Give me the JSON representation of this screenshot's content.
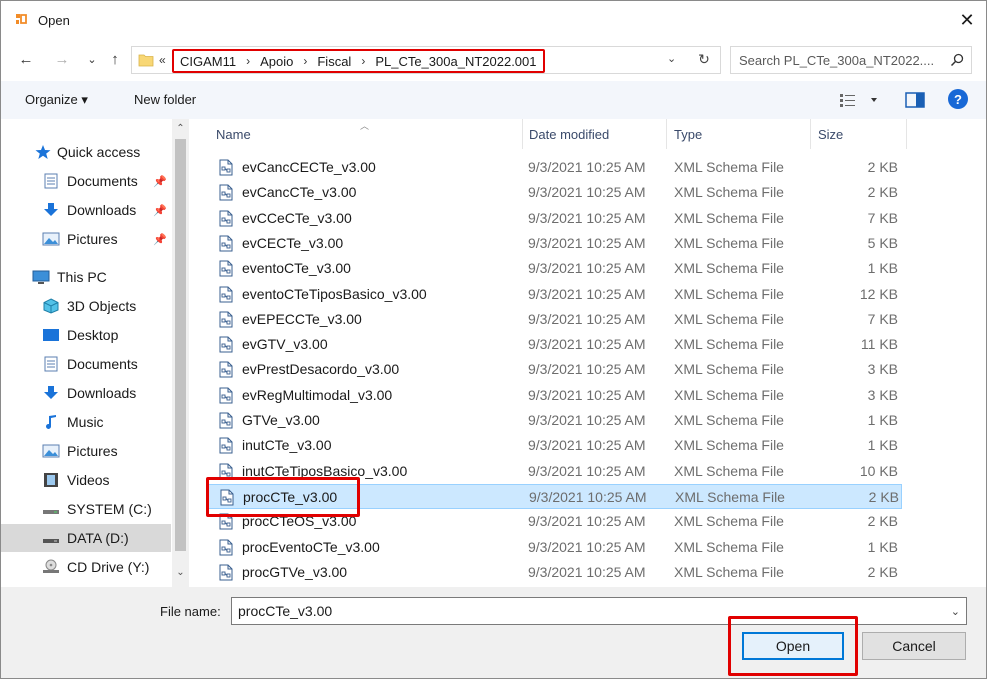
{
  "window": {
    "title": "Open",
    "close_glyph": "✕"
  },
  "address": {
    "overflow": "«",
    "crumbs": [
      "CIGAM11",
      "Apoio",
      "Fiscal",
      "PL_CTe_300a_NT2022.001"
    ],
    "separator": "›",
    "dropdown_glyph": "⌄",
    "refresh_glyph": "↻"
  },
  "nav_buttons": {
    "back": "←",
    "forward": "→",
    "recent": "⌄",
    "up": "↑"
  },
  "search": {
    "placeholder": "Search PL_CTe_300a_NT2022...."
  },
  "toolbar": {
    "organize": "Organize ▾",
    "new_folder": "New folder",
    "help": "?"
  },
  "nav_pane": {
    "items": [
      {
        "label": "Quick access",
        "icon": "star-icon",
        "pinned": false,
        "selected": false
      },
      {
        "label": "Documents",
        "icon": "documents-icon",
        "pinned": true,
        "selected": false
      },
      {
        "label": "Downloads",
        "icon": "downloads-icon",
        "pinned": true,
        "selected": false
      },
      {
        "label": "Pictures",
        "icon": "pictures-icon",
        "pinned": true,
        "selected": false
      },
      {
        "label": "This PC",
        "icon": "pc-icon",
        "pinned": false,
        "selected": false
      },
      {
        "label": "3D Objects",
        "icon": "cube-icon",
        "pinned": false,
        "selected": false
      },
      {
        "label": "Desktop",
        "icon": "desktop-icon",
        "pinned": false,
        "selected": false
      },
      {
        "label": "Documents",
        "icon": "documents-icon",
        "pinned": false,
        "selected": false
      },
      {
        "label": "Downloads",
        "icon": "downloads-icon",
        "pinned": false,
        "selected": false
      },
      {
        "label": "Music",
        "icon": "music-icon",
        "pinned": false,
        "selected": false
      },
      {
        "label": "Pictures",
        "icon": "pictures-icon",
        "pinned": false,
        "selected": false
      },
      {
        "label": "Videos",
        "icon": "videos-icon",
        "pinned": false,
        "selected": false
      },
      {
        "label": "SYSTEM (C:)",
        "icon": "drive-icon",
        "pinned": false,
        "selected": false
      },
      {
        "label": "DATA (D:)",
        "icon": "drive-icon",
        "pinned": false,
        "selected": true
      },
      {
        "label": "CD Drive (Y:)",
        "icon": "cd-drive-icon",
        "pinned": false,
        "selected": false
      }
    ]
  },
  "columns": {
    "name": "Name",
    "date": "Date modified",
    "type": "Type",
    "size": "Size"
  },
  "files": [
    {
      "name": "evCancCECTe_v3.00",
      "date": "9/3/2021 10:25 AM",
      "type": "XML Schema File",
      "size": "2 KB"
    },
    {
      "name": "evCancCTe_v3.00",
      "date": "9/3/2021 10:25 AM",
      "type": "XML Schema File",
      "size": "2 KB"
    },
    {
      "name": "evCCeCTe_v3.00",
      "date": "9/3/2021 10:25 AM",
      "type": "XML Schema File",
      "size": "7 KB"
    },
    {
      "name": "evCECTe_v3.00",
      "date": "9/3/2021 10:25 AM",
      "type": "XML Schema File",
      "size": "5 KB"
    },
    {
      "name": "eventoCTe_v3.00",
      "date": "9/3/2021 10:25 AM",
      "type": "XML Schema File",
      "size": "1 KB"
    },
    {
      "name": "eventoCTeTiposBasico_v3.00",
      "date": "9/3/2021 10:25 AM",
      "type": "XML Schema File",
      "size": "12 KB"
    },
    {
      "name": "evEPECCTe_v3.00",
      "date": "9/3/2021 10:25 AM",
      "type": "XML Schema File",
      "size": "7 KB"
    },
    {
      "name": "evGTV_v3.00",
      "date": "9/3/2021 10:25 AM",
      "type": "XML Schema File",
      "size": "11 KB"
    },
    {
      "name": "evPrestDesacordo_v3.00",
      "date": "9/3/2021 10:25 AM",
      "type": "XML Schema File",
      "size": "3 KB"
    },
    {
      "name": "evRegMultimodal_v3.00",
      "date": "9/3/2021 10:25 AM",
      "type": "XML Schema File",
      "size": "3 KB"
    },
    {
      "name": "GTVe_v3.00",
      "date": "9/3/2021 10:25 AM",
      "type": "XML Schema File",
      "size": "1 KB"
    },
    {
      "name": "inutCTe_v3.00",
      "date": "9/3/2021 10:25 AM",
      "type": "XML Schema File",
      "size": "1 KB"
    },
    {
      "name": "inutCTeTiposBasico_v3.00",
      "date": "9/3/2021 10:25 AM",
      "type": "XML Schema File",
      "size": "10 KB"
    },
    {
      "name": "procCTe_v3.00",
      "date": "9/3/2021 10:25 AM",
      "type": "XML Schema File",
      "size": "2 KB",
      "selected": true
    },
    {
      "name": "procCTeOS_v3.00",
      "date": "9/3/2021 10:25 AM",
      "type": "XML Schema File",
      "size": "2 KB"
    },
    {
      "name": "procEventoCTe_v3.00",
      "date": "9/3/2021 10:25 AM",
      "type": "XML Schema File",
      "size": "1 KB"
    },
    {
      "name": "procGTVe_v3.00",
      "date": "9/3/2021 10:25 AM",
      "type": "XML Schema File",
      "size": "2 KB"
    }
  ],
  "filename": {
    "label": "File name:",
    "value": "procCTe_v3.00",
    "dropdown_glyph": "⌄"
  },
  "buttons": {
    "open": "Open",
    "cancel": "Cancel"
  },
  "colors": {
    "accent": "#0078d7",
    "selection": "#cce8ff",
    "annotation": "#e10000"
  }
}
